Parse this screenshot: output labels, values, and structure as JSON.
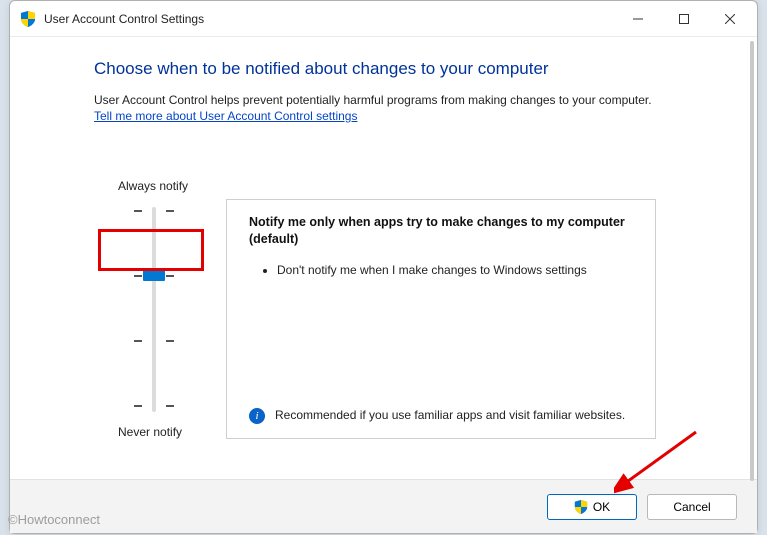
{
  "window": {
    "title": "User Account Control Settings"
  },
  "main": {
    "heading": "Choose when to be notified about changes to your computer",
    "description": "User Account Control helps prevent potentially harmful programs from making changes to your computer.",
    "help_link": "Tell me more about User Account Control settings"
  },
  "slider": {
    "top_label": "Always notify",
    "bottom_label": "Never notify",
    "level": 2
  },
  "panel": {
    "title": "Notify me only when apps try to make changes to my computer (default)",
    "bullet1": "Don't notify me when I make changes to Windows settings",
    "recommend": "Recommended if you use familiar apps and visit familiar websites."
  },
  "buttons": {
    "ok": "OK",
    "cancel": "Cancel"
  },
  "watermark": "©Howtoconnect"
}
